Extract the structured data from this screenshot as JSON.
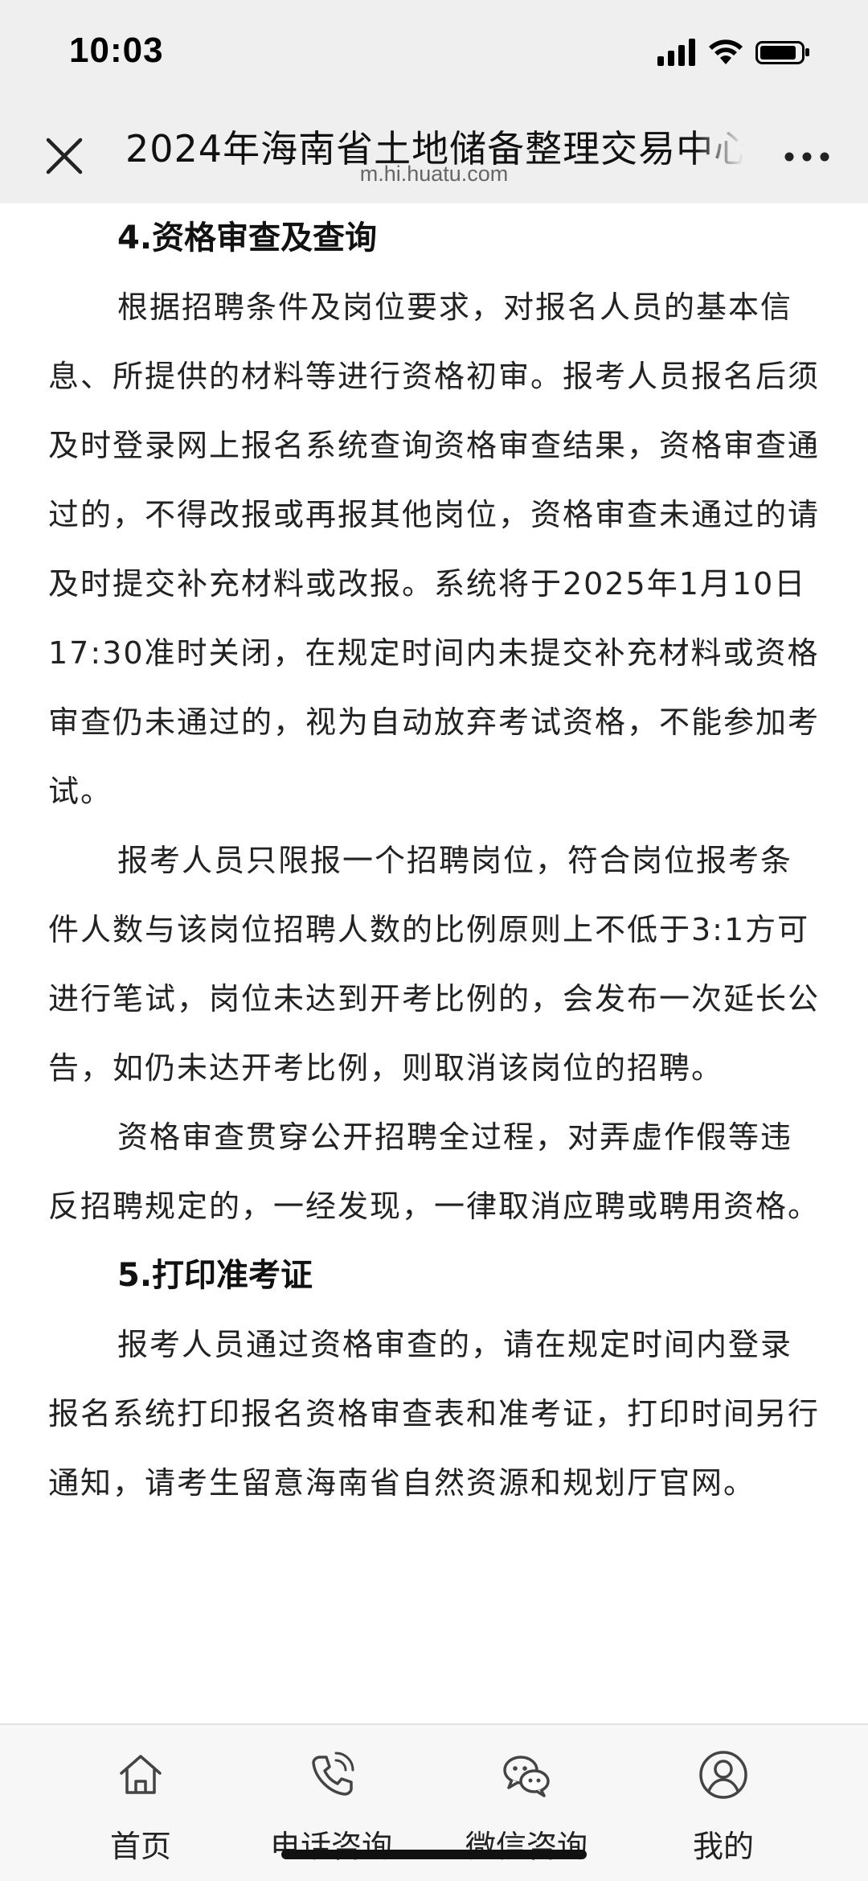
{
  "status_bar": {
    "time": "10:03"
  },
  "navbar": {
    "title": "2024年海南省土地储备整理交易中心",
    "domain": "m.hi.huatu.com"
  },
  "article": {
    "section4_heading": "4.资格审查及查询",
    "section4_p1": "根据招聘条件及岗位要求，对报名人员的基本信息、所提供的材料等进行资格初审。报考人员报名后须及时登录网上报名系统查询资格审查结果，资格审查通过的，不得改报或再报其他岗位，资格审查未通过的请及时提交补充材料或改报。系统将于2025年1月10日17:30准时关闭，在规定时间内未提交补充材料或资格审查仍未通过的，视为自动放弃考试资格，不能参加考试。",
    "section4_p2": "报考人员只限报一个招聘岗位，符合岗位报考条件人数与该岗位招聘人数的比例原则上不低于3:1方可进行笔试，岗位未达到开考比例的，会发布一次延长公告，如仍未达开考比例，则取消该岗位的招聘。",
    "section4_p3": "资格审查贯穿公开招聘全过程，对弄虚作假等违反招聘规定的，一经发现，一律取消应聘或聘用资格。",
    "section5_heading": "5.打印准考证",
    "section5_p1": "报考人员通过资格审查的，请在规定时间内登录报名系统打印报名资格审查表和准考证，打印时间另行通知，请考生留意海南省自然资源和规划厅官网。"
  },
  "bottom_nav": {
    "tabs": [
      {
        "label": "首页",
        "icon": "home-icon"
      },
      {
        "label": "电话咨询",
        "icon": "phone-icon"
      },
      {
        "label": "微信咨询",
        "icon": "wechat-icon"
      },
      {
        "label": "我的",
        "icon": "user-icon"
      }
    ]
  }
}
